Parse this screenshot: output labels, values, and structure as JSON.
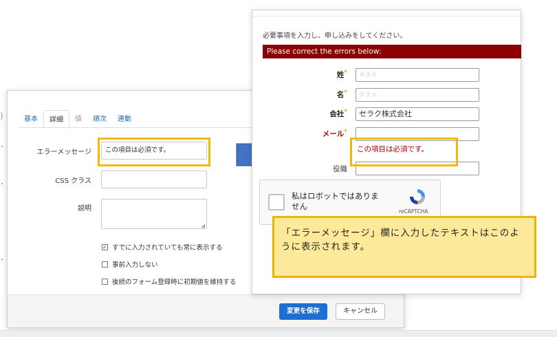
{
  "settings": {
    "tabs": [
      {
        "label": "基本"
      },
      {
        "label": "詳細"
      },
      {
        "label": "値"
      },
      {
        "label": "順次"
      },
      {
        "label": "連動"
      }
    ],
    "error_message_label": "エラーメッセージ",
    "error_message_value": "この項目は必須です。",
    "css_class_label": "CSS クラス",
    "css_class_value": "",
    "description_label": "説明",
    "description_value": "",
    "checkboxes": [
      {
        "label": "すでに入力されていても常に表示する",
        "checked": true
      },
      {
        "label": "事前入力しない",
        "checked": false
      },
      {
        "label": "後続のフォーム登録時に初期値を維持する",
        "checked": false
      }
    ],
    "save_label": "変更を保存",
    "cancel_label": "キャンセル"
  },
  "form": {
    "instruction": "必要事項を入力し、申し込みをしてください。",
    "error_banner": "Please correct the errors below:",
    "required_mark": "*",
    "fields": {
      "last_name_label": "姓",
      "last_name_value": "テスト",
      "first_name_label": "名",
      "first_name_value": "テスト",
      "company_label": "会社",
      "company_value": "セラク株式会社",
      "email_label": "メール",
      "email_value": "",
      "email_error": "この項目は必須です。",
      "title_label": "役職",
      "title_value": ""
    },
    "captcha": {
      "text": "私はロボットではありません",
      "brand": "reCAPTCHA"
    }
  },
  "callout": {
    "text": "「エラーメッセージ」欄に入力したテキストはこのように表示されます。"
  },
  "colors": {
    "error_banner": "#8b0000",
    "error_text": "#b00000",
    "highlight": "#f5b800",
    "arrow": "#4472c4",
    "callout_bg": "#fde99a",
    "primary_button": "#1f6fd0"
  }
}
